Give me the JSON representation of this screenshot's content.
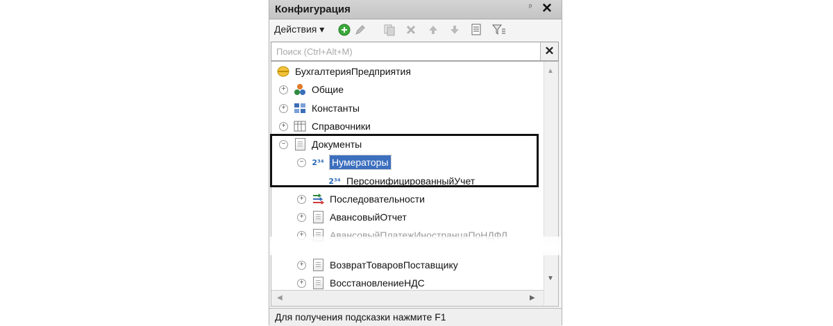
{
  "window": {
    "title": "Конфигурация",
    "pin_glyph": "ᵖ",
    "close_glyph": "✕"
  },
  "toolbar": {
    "actions_label": "Действия ▾",
    "icons": [
      "add-icon",
      "edit-icon",
      "copy-icon",
      "delete-icon",
      "move-up-icon",
      "move-down-icon",
      "list-icon",
      "filter-icon"
    ]
  },
  "search": {
    "placeholder": "Поиск (Ctrl+Alt+M)",
    "clear_glyph": "✕"
  },
  "tree": {
    "root": "БухгалтерияПредприятия",
    "items": [
      {
        "label": "Общие",
        "expander": "+"
      },
      {
        "label": "Константы",
        "expander": "+"
      },
      {
        "label": "Справочники",
        "expander": "+"
      },
      {
        "label": "Документы",
        "expander": "−"
      },
      {
        "label": "Нумераторы",
        "expander": "−",
        "selected": true
      },
      {
        "label": "ПерсонифицированныйУчет"
      },
      {
        "label": "Последовательности",
        "expander": "+"
      },
      {
        "label": "АвансовыйОтчет",
        "expander": "+"
      },
      {
        "label": "АвансовыйПлатежИностранцаПоНДФЛ",
        "expander": "+"
      },
      {
        "label": "ВозвратТоваровПоставщику",
        "expander": "+"
      },
      {
        "label": "ВосстановлениеНДС",
        "expander": "+"
      }
    ],
    "num_icon_text": "2³⁴"
  },
  "status": {
    "text": "Для получения подсказки нажмите F1"
  },
  "colors": {
    "selection": "#3c6fbe",
    "highlight_border": "#111111"
  }
}
